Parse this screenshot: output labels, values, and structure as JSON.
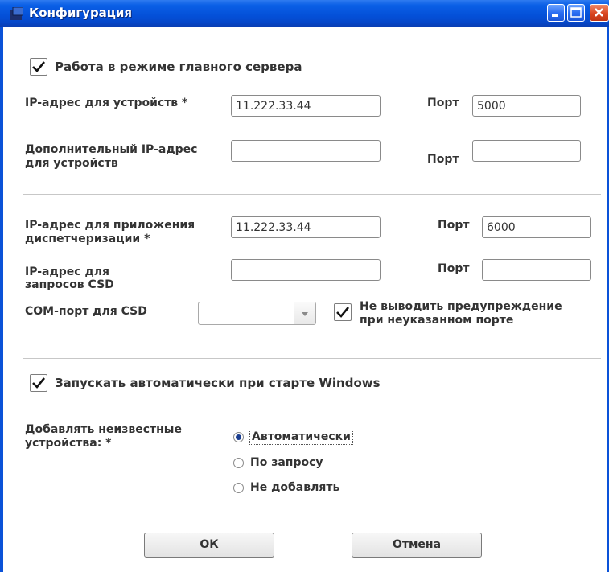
{
  "window": {
    "title": "Конфигурация",
    "buttons": [
      "minimize-button",
      "maximize-button",
      "close-button"
    ],
    "colors": {
      "titlebar": "#0450d8",
      "close": "#d9451f"
    }
  },
  "main_server": {
    "label": "Работа в режиме главного сервера",
    "checked": true
  },
  "devices": {
    "ip_label": "IP-адрес для устройств *",
    "ip_value": "11.222.33.44",
    "port_label": "Порт",
    "port_value": "5000",
    "extra_ip_label_1": "Дополнительный IP-адрес",
    "extra_ip_label_2": "для устройств",
    "extra_ip_value": "",
    "extra_port_label": "Порт",
    "extra_port_value": ""
  },
  "dispatch": {
    "ip_label_1": "IP-адрес для приложения",
    "ip_label_2": "диспетчеризации *",
    "ip_value": "11.222.33.44",
    "port_label": "Порт",
    "port_value": "6000"
  },
  "csd": {
    "ip_label_1": "IP-адрес для",
    "ip_label_2": "запросов CSD",
    "ip_value": "",
    "port_label": "Порт",
    "port_value": "",
    "com_label": "COM-порт для CSD",
    "com_value": "",
    "warn_label_1": "Не выводить предупреждение",
    "warn_label_2": "при неуказанном порте",
    "warn_checked": true
  },
  "autostart": {
    "label": "Запускать автоматически при старте Windows",
    "checked": true
  },
  "unknown_devices": {
    "label_1": "Добавлять неизвестные",
    "label_2": "устройства: *",
    "options": [
      "Автоматически",
      "По запросу",
      "Не добавлять"
    ],
    "selected": "Автоматически"
  },
  "buttons": {
    "ok": "ОК",
    "cancel": "Отмена"
  }
}
